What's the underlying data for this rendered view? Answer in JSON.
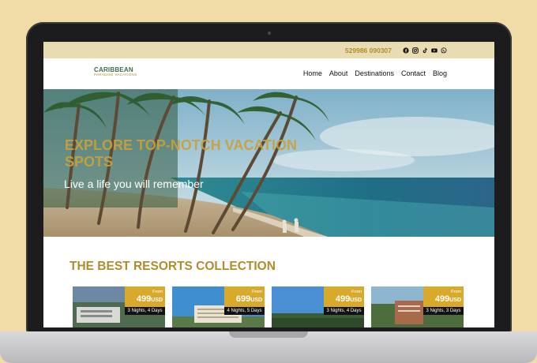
{
  "topbar": {
    "phone": "529986 090307",
    "social_icons": [
      "facebook-icon",
      "instagram-icon",
      "tiktok-icon",
      "youtube-icon",
      "whatsapp-icon"
    ]
  },
  "nav": {
    "logo_main": "CARIBBEAN",
    "logo_sub": "PARADISE VACATIONS",
    "items": [
      {
        "label": "Home"
      },
      {
        "label": "About"
      },
      {
        "label": "Destinations"
      },
      {
        "label": "Contact"
      },
      {
        "label": "Blog"
      }
    ]
  },
  "hero": {
    "title": "EXPLORE TOP-NOTCH VACATION SPOTS",
    "subtitle": "Live a life you will remember"
  },
  "resorts": {
    "title": "THE BEST RESORTS COLLECTION",
    "cards": [
      {
        "from": "From",
        "price": "499",
        "currency": "USD",
        "nights": "3 Nights, 4 Days"
      },
      {
        "from": "From",
        "price": "699",
        "currency": "USD",
        "nights": "4 Nights, 5 Days"
      },
      {
        "from": "From",
        "price": "499",
        "currency": "USD",
        "nights": "3 Nights, 4 Days"
      },
      {
        "from": "From",
        "price": "499",
        "currency": "USD",
        "nights": "3 Nights, 3 Days"
      }
    ]
  },
  "colors": {
    "background": "#f1dba6",
    "accent_gold": "#b08d2c",
    "price_badge": "#d8aa2c",
    "topbar": "#e9dcb2"
  }
}
